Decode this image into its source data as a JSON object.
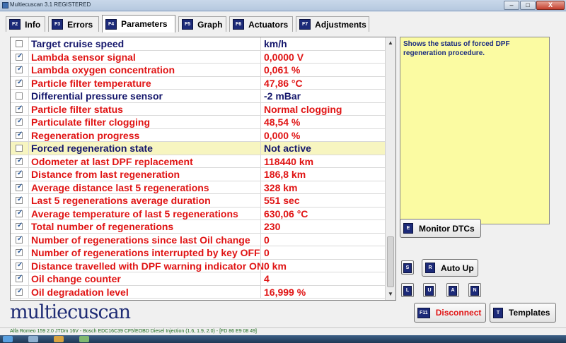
{
  "window": {
    "title": "Multiecuscan 3.1 REGISTERED",
    "min_glyph": "–",
    "max_glyph": "□",
    "close_glyph": "X"
  },
  "tabs": [
    {
      "key": "F2",
      "label": "Info",
      "active": false
    },
    {
      "key": "F3",
      "label": "Errors",
      "active": false
    },
    {
      "key": "F4",
      "label": "Parameters",
      "active": true
    },
    {
      "key": "F5",
      "label": "Graph",
      "active": false
    },
    {
      "key": "F6",
      "label": "Actuators",
      "active": false
    },
    {
      "key": "F7",
      "label": "Adjustments",
      "active": false
    }
  ],
  "parameters": [
    {
      "name": "Target cruise speed",
      "value": "km/h",
      "checked": false,
      "color": "navy"
    },
    {
      "name": "Lambda sensor signal",
      "value": "0,0000 V",
      "checked": true,
      "color": "red"
    },
    {
      "name": "Lambda oxygen concentration",
      "value": "0,061 %",
      "checked": true,
      "color": "red"
    },
    {
      "name": "Particle filter temperature",
      "value": "47,86 °C",
      "checked": true,
      "color": "red"
    },
    {
      "name": "Differential pressure sensor",
      "value": "-2 mBar",
      "checked": false,
      "color": "navy"
    },
    {
      "name": "Particle filter status",
      "value": "Normal clogging",
      "checked": true,
      "color": "red"
    },
    {
      "name": "Particulate filter clogging",
      "value": "48,54 %",
      "checked": true,
      "color": "red"
    },
    {
      "name": "Regeneration progress",
      "value": "0,000 %",
      "checked": true,
      "color": "red"
    },
    {
      "name": "Forced regeneration state",
      "value": "Not active",
      "checked": false,
      "color": "navy",
      "selected": true
    },
    {
      "name": "Odometer at last DPF replacement",
      "value": "118440 km",
      "checked": true,
      "color": "red"
    },
    {
      "name": "Distance from last regeneration",
      "value": "186,8 km",
      "checked": true,
      "color": "red"
    },
    {
      "name": "Average distance last 5 regenerations",
      "value": "328 km",
      "checked": true,
      "color": "red"
    },
    {
      "name": "Last 5 regenerations average duration",
      "value": "551 sec",
      "checked": true,
      "color": "red"
    },
    {
      "name": "Average temperature of last 5 regenerations",
      "value": "630,06 °C",
      "checked": true,
      "color": "red"
    },
    {
      "name": "Total number of regenerations",
      "value": "230",
      "checked": true,
      "color": "red"
    },
    {
      "name": "Number of regenerations since last Oil change",
      "value": "0",
      "checked": true,
      "color": "red"
    },
    {
      "name": "Number of regenerations interrupted by key OFF",
      "value": "0",
      "checked": true,
      "color": "red"
    },
    {
      "name": "Distance travelled with DPF warning indicator ON",
      "value": "0 km",
      "checked": true,
      "color": "red"
    },
    {
      "name": "Oil change counter",
      "value": "4",
      "checked": true,
      "color": "red"
    },
    {
      "name": "Oil degradation level",
      "value": "16,999 %",
      "checked": true,
      "color": "red"
    }
  ],
  "info_text": "Shows the status of forced DPF regeneration procedure.",
  "buttons": {
    "monitor_dtcs": {
      "key": "E",
      "label": "Monitor DTCs"
    },
    "s": {
      "key": "S"
    },
    "auto_up": {
      "key": "R",
      "label": "Auto Up"
    },
    "l": {
      "key": "L"
    },
    "u": {
      "key": "U"
    },
    "a": {
      "key": "A"
    },
    "n": {
      "key": "N"
    },
    "disconnect": {
      "key": "F11",
      "label": "Disconnect"
    },
    "templates": {
      "key": "T",
      "label": "Templates"
    }
  },
  "logo": "multiecuscan",
  "status": "Alfa Romeo 159 2.0 JTDm 16V - Bosch EDC16C39 CF5/EOBD Diesel Injection (1.6, 1.9, 2.0) - [FD 86 E9 08 49]",
  "colors": {
    "accent_navy": "#1c2a78",
    "value_red": "#e01414",
    "info_yellow": "#fbfba2",
    "status_green": "#1b6a1b"
  }
}
